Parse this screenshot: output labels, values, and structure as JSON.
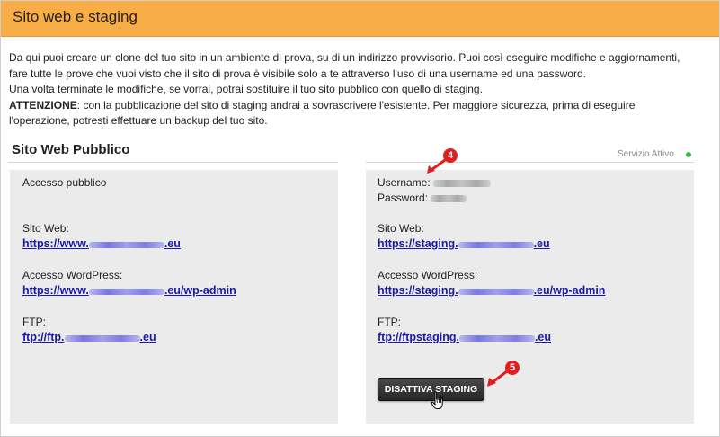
{
  "header": {
    "title": "Sito web e staging"
  },
  "intro": {
    "line1": "Da qui puoi creare un clone del tuo sito in un ambiente di prova, su di un indirizzo provvisorio. Puoi così eseguire modifiche e aggiornamenti,",
    "line2": "fare tutte le prove che vuoi visto che il sito di prova è visibile solo a te attraverso l'uso di una username ed una password.",
    "line3": "Una volta terminate le modifiche, se vorrai, potrai sostituire il tuo sito pubblico con quello di staging.",
    "warning_label": "ATTENZIONE",
    "line4_rest": ": con la pubblicazione del sito di staging andrai a sovrascrivere l'esistente. Per maggiore sicurezza, prima di eseguire",
    "line5": "l'operazione, potresti effettuare un backup del tuo sito."
  },
  "section": {
    "title": "Sito Web Pubblico",
    "service_status": "Servizio Attivo",
    "status_color": "#3dbb3d"
  },
  "public_panel": {
    "access_label": "Accesso pubblico",
    "website_label": "Sito Web:",
    "website_url_prefix": "https://www.",
    "website_url_suffix": ".eu",
    "wordpress_label": "Accesso WordPress:",
    "wordpress_url_prefix": "https://www.",
    "wordpress_url_suffix": ".eu/wp-admin",
    "ftp_label": "FTP:",
    "ftp_url_prefix": "ftp://ftp.",
    "ftp_url_suffix": ".eu"
  },
  "staging_panel": {
    "username_label": "Username:",
    "password_label": "Password:",
    "website_label": "Sito Web:",
    "website_url_prefix": "https://staging.",
    "website_url_suffix": ".eu",
    "wordpress_label": "Accesso WordPress:",
    "wordpress_url_prefix": "https://staging.",
    "wordpress_url_suffix": ".eu/wp-admin",
    "ftp_label": "FTP:",
    "ftp_url_prefix": "ftp://ftpstaging.",
    "ftp_url_suffix": ".eu",
    "disable_button_label": "DISATTIVA STAGING"
  },
  "annotations": {
    "step_4": "4",
    "step_5": "5",
    "color": "#e21d1d"
  }
}
